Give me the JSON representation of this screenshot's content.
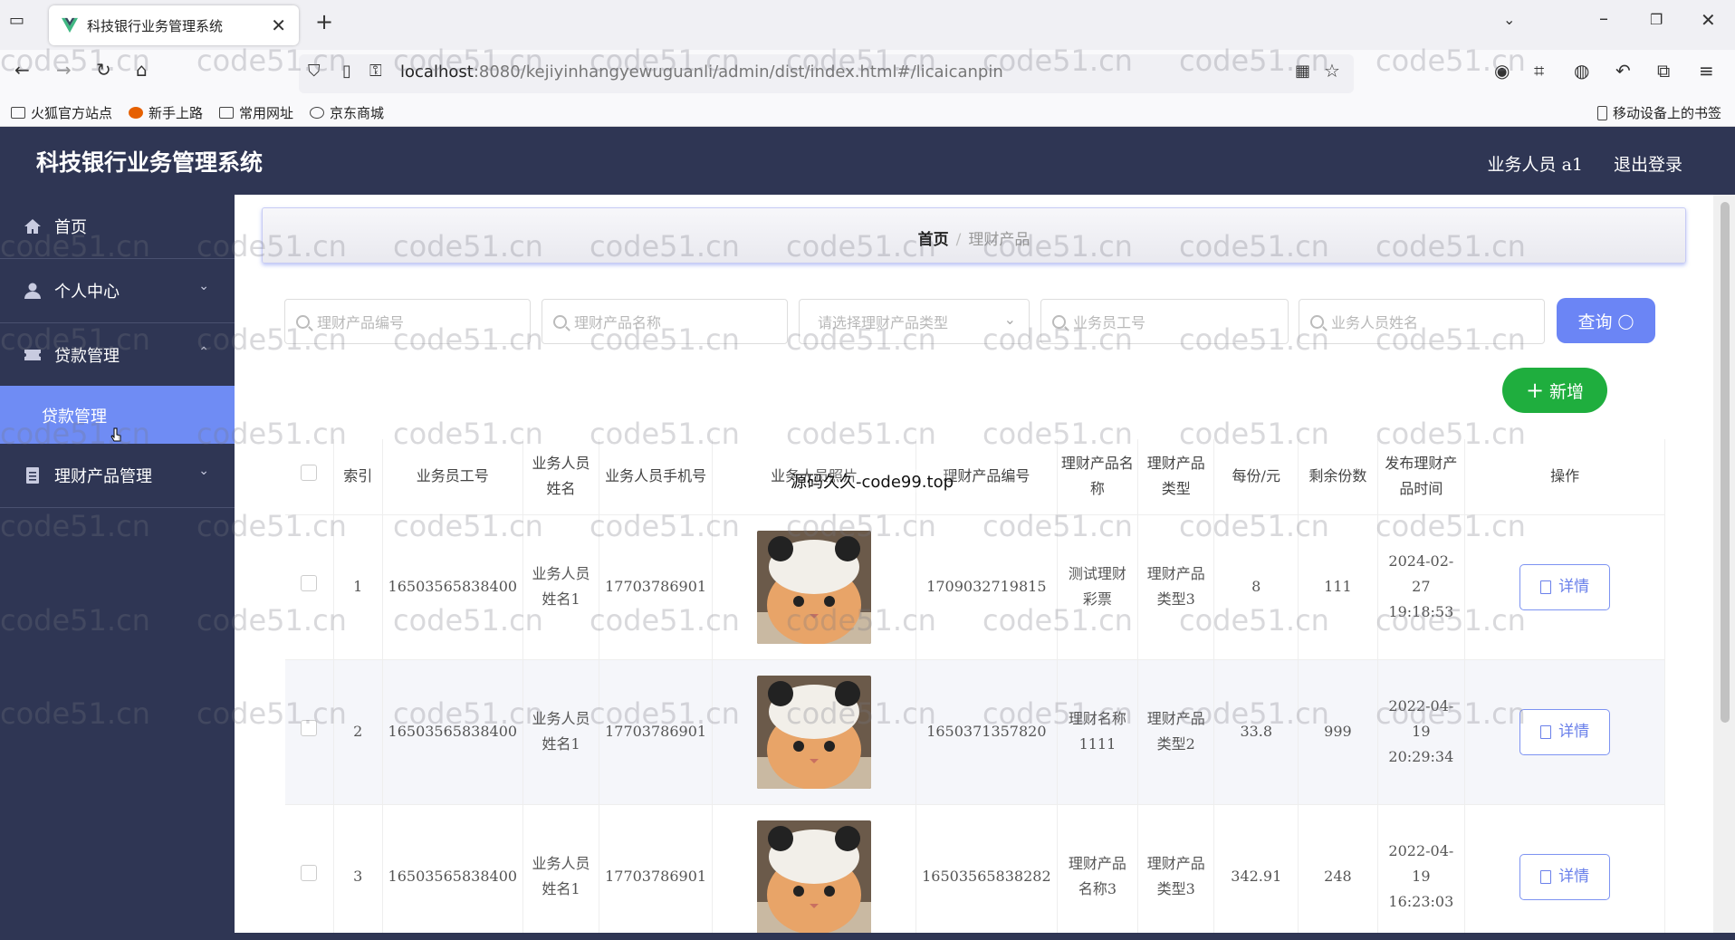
{
  "browser": {
    "tab_title": "科技银行业务管理系统",
    "url_host": "localhost",
    "url_rest": ":8080/kejiyinhangyewuguanli/admin/dist/index.html#/licaicanpin",
    "bookmarks": [
      "火狐官方站点",
      "新手上路",
      "常用网址",
      "京东商城"
    ],
    "mobile_bookmarks": "移动设备上的书签"
  },
  "header": {
    "title": "科技银行业务管理系统",
    "user": "业务人员 a1",
    "logout": "退出登录"
  },
  "sidebar": {
    "items": [
      {
        "label": "首页",
        "icon": "home-icon"
      },
      {
        "label": "个人中心",
        "icon": "user-icon"
      },
      {
        "label": "贷款管理",
        "icon": "ticket-icon"
      },
      {
        "label": "理财产品管理",
        "icon": "document-icon"
      }
    ],
    "active_sub": "贷款管理"
  },
  "breadcrumb": {
    "home": "首页",
    "sep": "/",
    "current": "理财产品"
  },
  "search": {
    "product_no": "理财产品编号",
    "product_name": "理财产品名称",
    "product_type": "请选择理财产品类型",
    "staff_no": "业务员工号",
    "staff_name": "业务人员姓名",
    "query": "查询",
    "add": "新增"
  },
  "table": {
    "headers": [
      "索引",
      "业务员工号",
      "业务人员姓名",
      "业务人员手机号",
      "业务人员照片",
      "理财产品编号",
      "理财产品名称",
      "理财产品类型",
      "每份/元",
      "剩余份数",
      "发布理财产品时间",
      "操作"
    ],
    "rows": [
      {
        "index": "1",
        "staff_no": "16503565838400",
        "staff_name": "业务人员姓名1",
        "phone": "17703786901",
        "product_no": "1709032719815",
        "product_name": "测试理财彩票",
        "type": "理财产品类型3",
        "price": "8",
        "remaining": "111",
        "time": "2024-02-27 19:18:53"
      },
      {
        "index": "2",
        "staff_no": "16503565838400",
        "staff_name": "业务人员姓名1",
        "phone": "17703786901",
        "product_no": "1650371357820",
        "product_name": "理财名称1111",
        "type": "理财产品类型2",
        "price": "33.8",
        "remaining": "999",
        "time": "2022-04-19 20:29:34"
      },
      {
        "index": "3",
        "staff_no": "16503565838400",
        "staff_name": "业务人员姓名1",
        "phone": "17703786901",
        "product_no": "16503565838282",
        "product_name": "理财产品名称3",
        "type": "理财产品类型3",
        "price": "342.91",
        "remaining": "248",
        "time": "2022-04-19 16:23:03"
      }
    ],
    "detail": "详情"
  },
  "overlay": "源码久久-code99.top",
  "watermark": "code51.cn",
  "colors": {
    "header_bg": "#2f3654",
    "active_menu": "#6f8cf4",
    "query_btn": "#6b85f5",
    "add_btn": "#1fae3e"
  }
}
